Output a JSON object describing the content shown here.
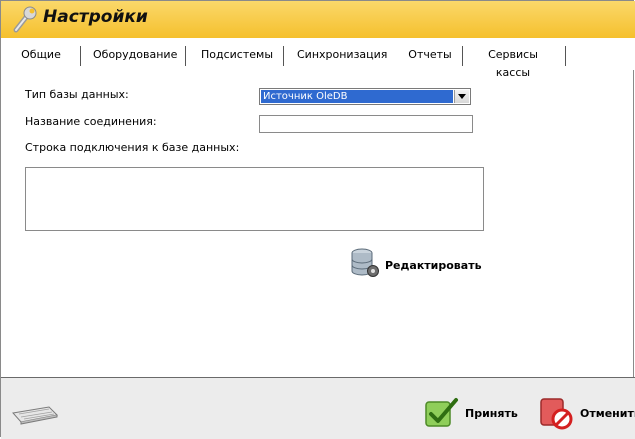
{
  "window": {
    "title": "Настройки"
  },
  "tabs": [
    {
      "label": "Общие"
    },
    {
      "label": "Оборудование"
    },
    {
      "label": "Подсистемы"
    },
    {
      "label": "Синхронизация"
    },
    {
      "label": "Отчеты"
    },
    {
      "label": "Сервисы кассы"
    }
  ],
  "form": {
    "db_type_label": "Тип базы данных:",
    "db_type_value": "Источник OleDB",
    "connection_name_label": "Название соединения:",
    "connection_name_value": "",
    "connection_string_label": "Строка подключения к базе данных:",
    "connection_string_value": "",
    "edit_button_label": "Редактировать"
  },
  "footer": {
    "accept_label": "Принять",
    "cancel_label": "Отменить"
  },
  "icons": {
    "title": "wrench-icon",
    "edit": "database-settings-icon",
    "keyboard": "keyboard-icon",
    "accept": "checkmark-icon",
    "cancel": "cancel-icon"
  },
  "colors": {
    "titlebar": "#f5c02d",
    "selection": "#2f6ad0"
  }
}
